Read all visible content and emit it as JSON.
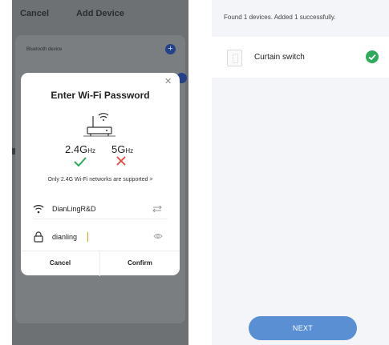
{
  "left_screen": {
    "header": {
      "cancel_label": "Cancel",
      "title": "Add Device"
    },
    "list": {
      "section_label": "Bluetooth device",
      "add_icon": "plus-circle-icon"
    },
    "dialog": {
      "title": "Enter Wi-Fi Password",
      "close_icon": "close-icon",
      "band_24": {
        "main": "2.4G",
        "unit": "Hz"
      },
      "band_5": {
        "main": "5G",
        "unit": "Hz"
      },
      "supported_note": "Only 2.4G Wi-Fi networks are supported >",
      "ssid": "DianLingR&D",
      "password": "dianling",
      "cancel_label": "Cancel",
      "confirm_label": "Confirm"
    }
  },
  "right_screen": {
    "status_text": "Found 1 devices. Added 1 successfully.",
    "device": {
      "name": "Curtain switch",
      "status_icon": "check-circle-icon"
    },
    "next_label": "NEXT"
  },
  "colors": {
    "success_green": "#2eaa5b",
    "error_red": "#e8453c",
    "primary_blue": "#5b8fd3",
    "overlay_gray": "#6e7173"
  }
}
